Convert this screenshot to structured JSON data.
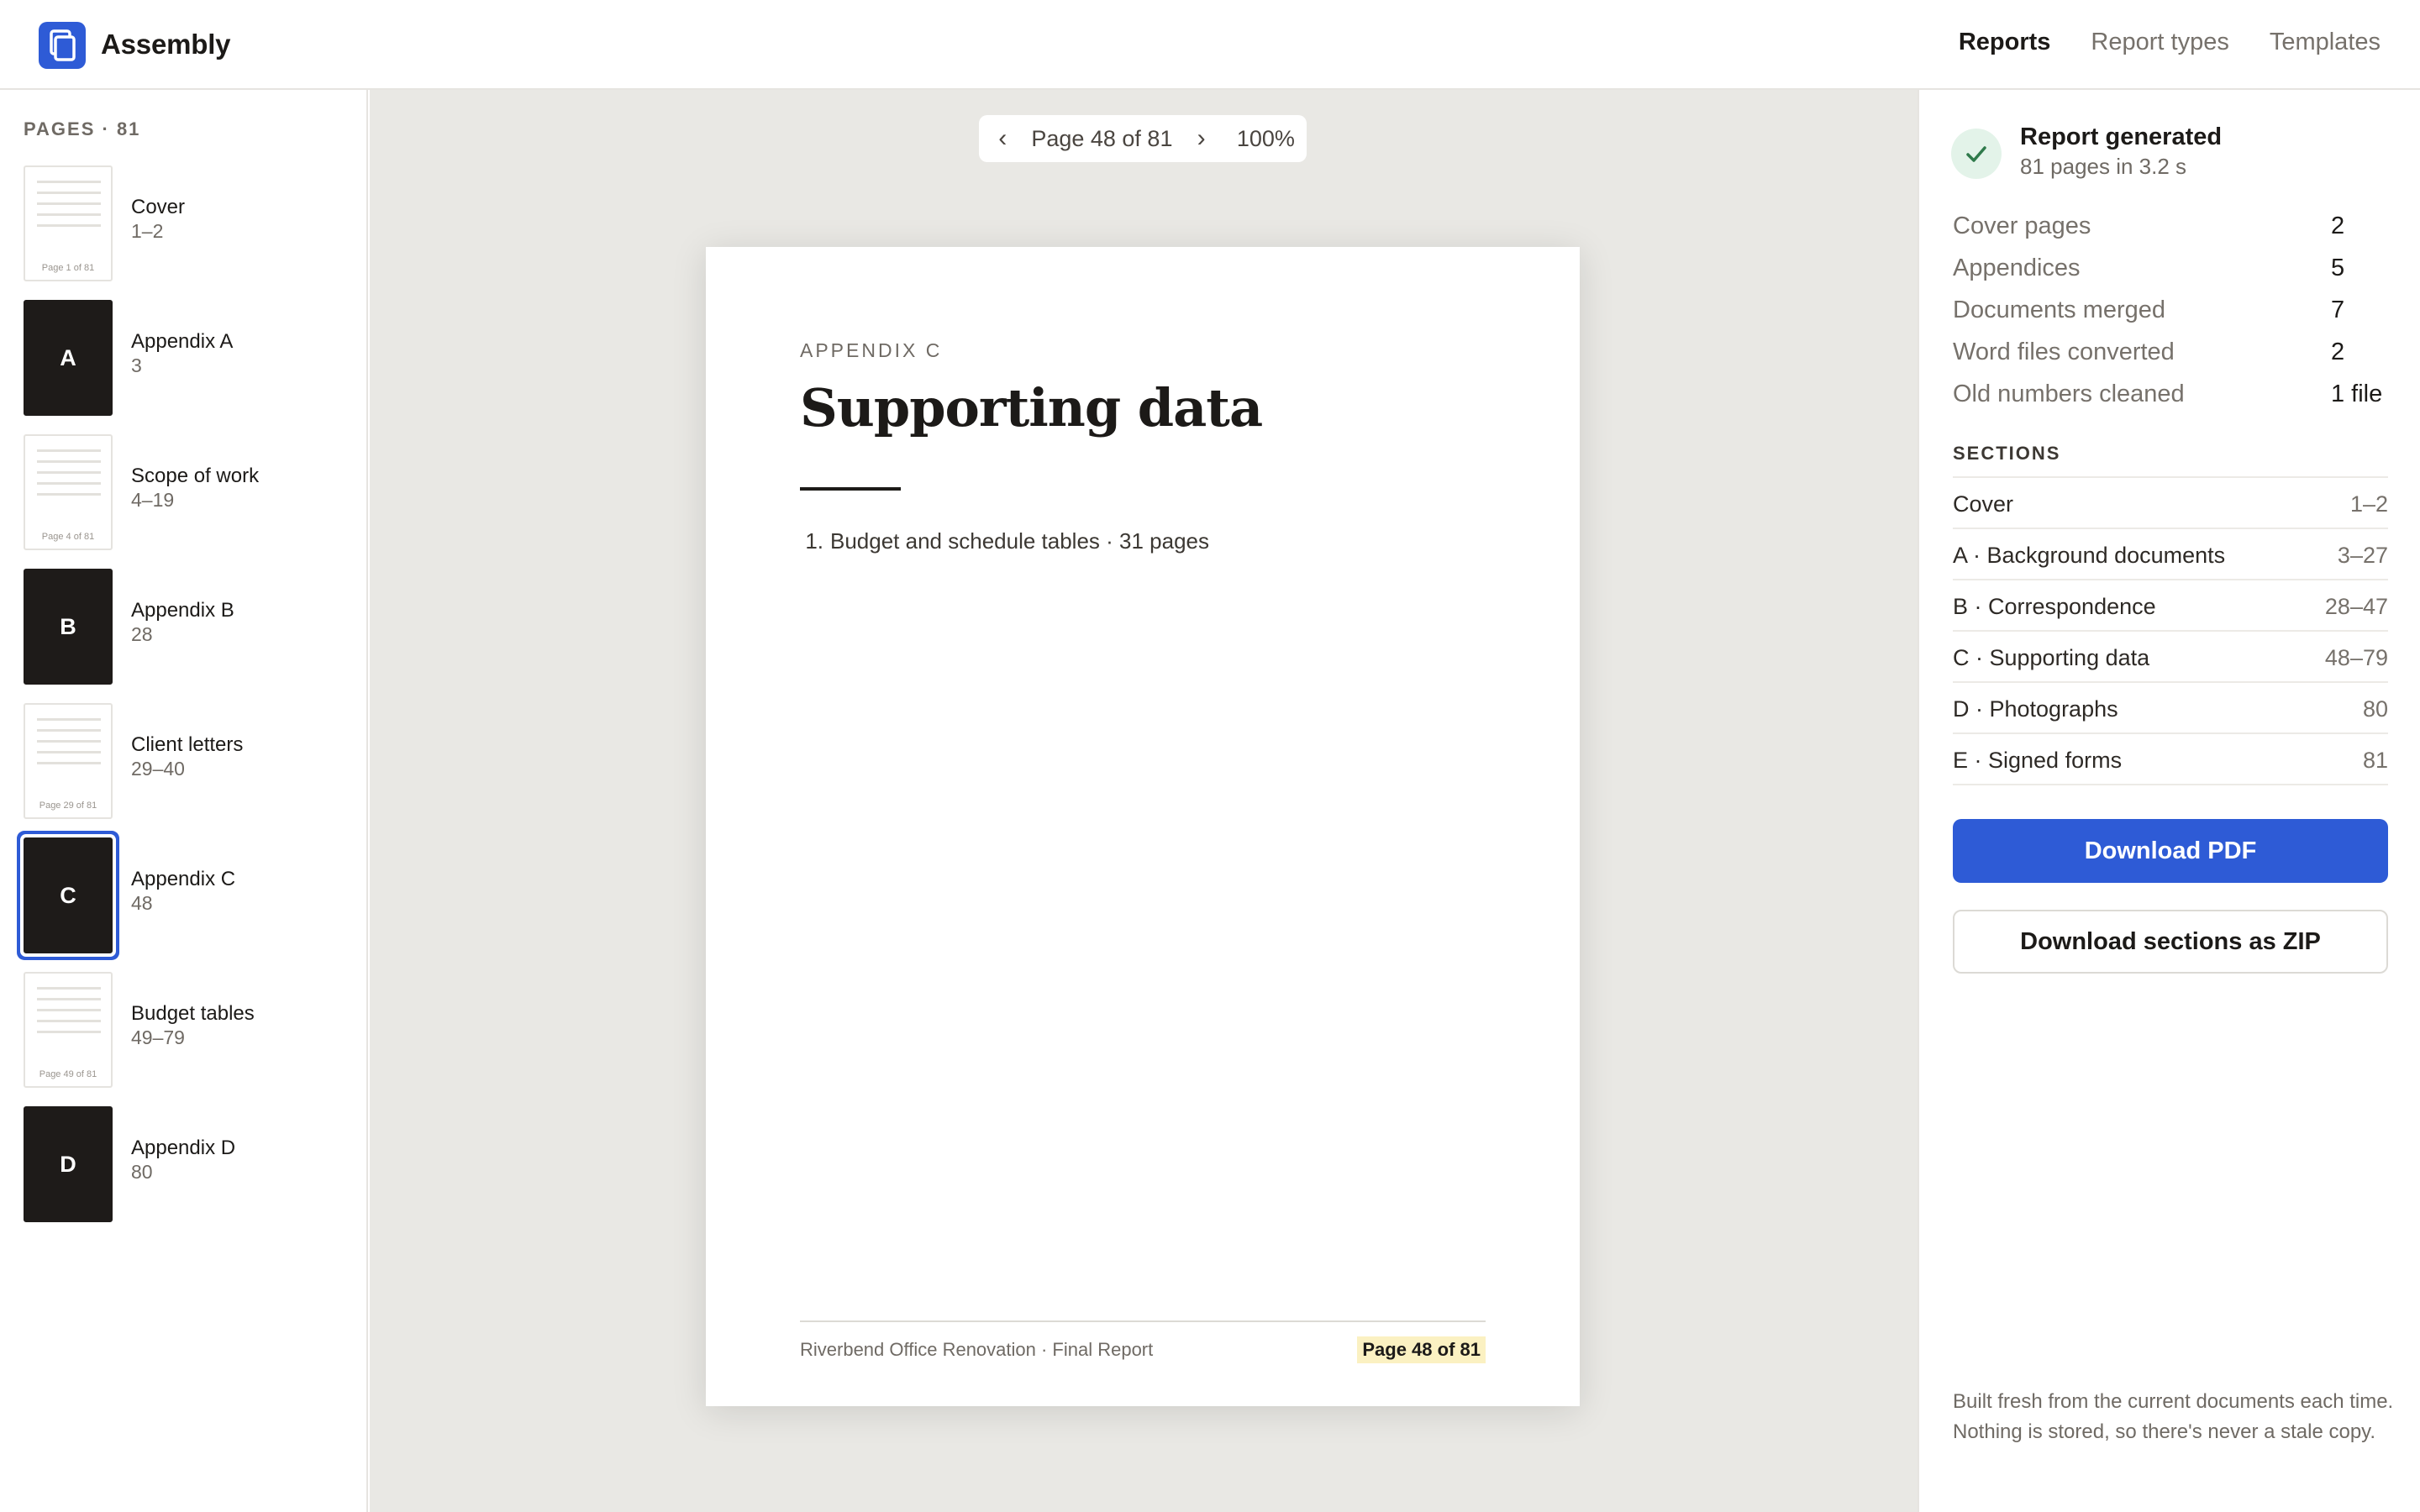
{
  "app": {
    "name": "Assembly",
    "nav": [
      {
        "label": "Reports",
        "active": true
      },
      {
        "label": "Report types",
        "active": false
      },
      {
        "label": "Templates",
        "active": false
      }
    ]
  },
  "sidebar": {
    "heading": "PAGES · 81",
    "items": [
      {
        "title": "Cover",
        "range": "1–2",
        "thumb": "page",
        "thumb_label": "Page 1 of 81"
      },
      {
        "title": "Appendix A",
        "range": "3",
        "thumb": "divider",
        "letter": "A"
      },
      {
        "title": "Scope of work",
        "range": "4–19",
        "thumb": "page",
        "thumb_label": "Page 4 of 81"
      },
      {
        "title": "Appendix B",
        "range": "28",
        "thumb": "divider",
        "letter": "B"
      },
      {
        "title": "Client letters",
        "range": "29–40",
        "thumb": "page",
        "thumb_label": "Page 29 of 81"
      },
      {
        "title": "Appendix C",
        "range": "48",
        "thumb": "divider",
        "letter": "C",
        "selected": true
      },
      {
        "title": "Budget tables",
        "range": "49–79",
        "thumb": "page",
        "thumb_label": "Page 49 of 81"
      },
      {
        "title": "Appendix D",
        "range": "80",
        "thumb": "divider",
        "letter": "D"
      }
    ]
  },
  "viewer": {
    "prev_icon": "‹",
    "next_icon": "›",
    "page_label": "Page 48 of 81",
    "zoom": "100%"
  },
  "document": {
    "kicker": "APPENDIX C",
    "title": "Supporting data",
    "list": [
      {
        "num": "1.",
        "text": "Budget and schedule tables · 31 pages"
      }
    ],
    "footer_left": "Riverbend Office Renovation · Final Report",
    "footer_right": "Page 48 of 81"
  },
  "panel": {
    "status_title": "Report generated",
    "status_sub": "81 pages in 3.2 s",
    "stats": [
      {
        "label": "Cover pages",
        "value": "2"
      },
      {
        "label": "Appendices",
        "value": "5"
      },
      {
        "label": "Documents merged",
        "value": "7"
      },
      {
        "label": "Word files converted",
        "value": "2"
      },
      {
        "label": "Old numbers cleaned",
        "value": "1 file"
      }
    ],
    "sections_heading": "SECTIONS",
    "sections": [
      {
        "name": "Cover",
        "range": "1–2"
      },
      {
        "name": "A · Background documents",
        "range": "3–27"
      },
      {
        "name": "B · Correspondence",
        "range": "28–47"
      },
      {
        "name": "C · Supporting data",
        "range": "48–79"
      },
      {
        "name": "D · Photographs",
        "range": "80"
      },
      {
        "name": "E · Signed forms",
        "range": "81"
      }
    ],
    "download_pdf": "Download PDF",
    "download_zip": "Download sections as ZIP",
    "note": "Built fresh from the current documents each time. Nothing is stored, so there's never a stale copy."
  },
  "colors": {
    "accent": "#2e5bd6",
    "success_bg": "#e3f3e9",
    "success": "#2f7a4b",
    "canvas_bg": "#e9e8e4",
    "divider_thumb": "#1e1b19",
    "footer_highlight": "#fbf1c2"
  },
  "icons": {
    "logo": "copy-pages-icon",
    "status": "check-icon",
    "prev": "chevron-left-icon",
    "next": "chevron-right-icon"
  }
}
